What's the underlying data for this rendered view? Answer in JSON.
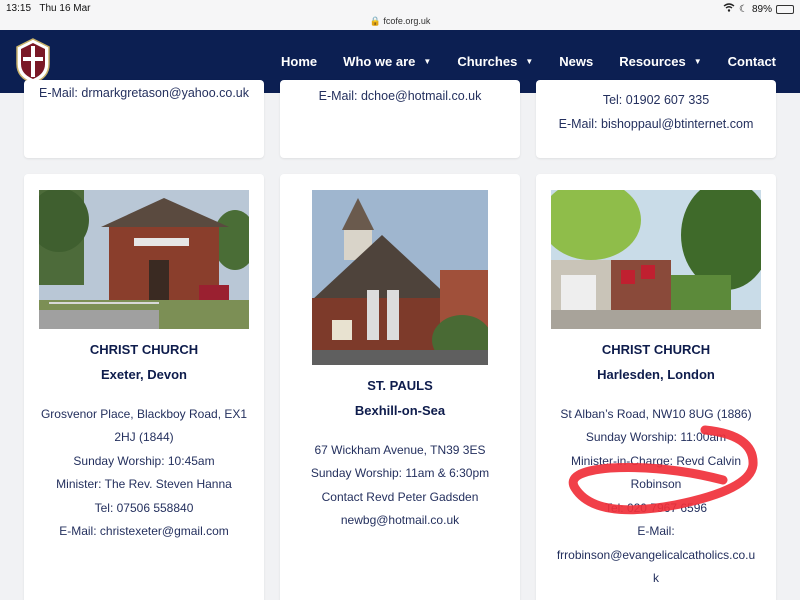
{
  "status": {
    "time": "13:15",
    "date": "Thu 16 Mar",
    "url": "fcofe.org.uk",
    "battery": "89%",
    "battery_level": 0.89
  },
  "nav": {
    "logo": "church-crest-logo",
    "items": [
      {
        "label": "Home",
        "dropdown": false
      },
      {
        "label": "Who we are",
        "dropdown": true
      },
      {
        "label": "Churches",
        "dropdown": true
      },
      {
        "label": "News",
        "dropdown": false
      },
      {
        "label": "Resources",
        "dropdown": true
      },
      {
        "label": "Contact",
        "dropdown": false
      }
    ]
  },
  "top_cards": [
    {
      "lines": [
        "E-Mail: drmarkgretason@yahoo.co.uk"
      ]
    },
    {
      "lines": [
        "E-Mail: dchoe@hotmail.co.uk"
      ]
    },
    {
      "lines": [
        "Tel: 01902 607 335",
        "E-Mail: bishoppaul@btinternet.com"
      ]
    }
  ],
  "churches": [
    {
      "name": "CHRIST CHURCH",
      "location": "Exeter, Devon",
      "details": [
        "Grosvenor Place, Blackboy Road, EX1",
        "2HJ (1844)",
        "Sunday Worship: 10:45am",
        "Minister: The Rev. Steven Hanna",
        "Tel: 07506 558840",
        "E-Mail: christexeter@gmail.com"
      ]
    },
    {
      "name": "ST. PAULS",
      "location": "Bexhill-on-Sea",
      "details": [
        "67 Wickham Avenue, TN39 3ES",
        "Sunday Worship: 11am & 6:30pm",
        "Contact Revd Peter Gadsden",
        "newbg@hotmail.co.uk"
      ]
    },
    {
      "name": "CHRIST CHURCH",
      "location": "Harlesden, London",
      "details": [
        "St Alban’s Road, NW10 8UG (1886)",
        "Sunday Worship: 11:00am",
        "Minister-in-Charge: Revd Calvin",
        "Robinson",
        "Tel: 020 7967 6596",
        "E-Mail:",
        "frrobinson@evangelicalcatholics.co.u",
        "k"
      ]
    }
  ],
  "colors": {
    "navbar": "#0c1f52",
    "text": "#24305e",
    "annotation": "#f0303a"
  }
}
